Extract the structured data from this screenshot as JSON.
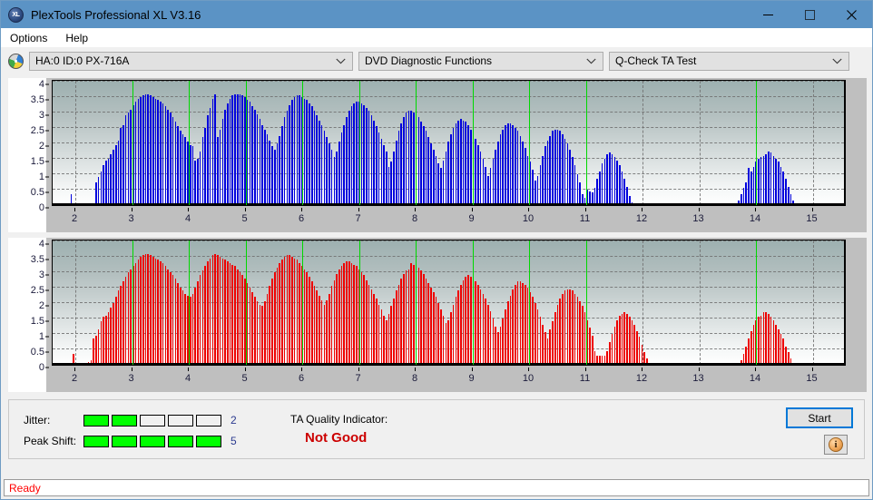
{
  "window": {
    "title": "PlexTools Professional XL V3.16",
    "app_icon": "XL",
    "controls": {
      "minimize": "minimize-icon",
      "maximize": "maximize-icon",
      "close": "close-icon"
    }
  },
  "menubar": {
    "items": [
      {
        "label": "Options"
      },
      {
        "label": "Help"
      }
    ]
  },
  "selectbar": {
    "drive_icon": "disc-icon",
    "drive": "HA:0 ID:0  PX-716A",
    "function_group": "DVD Diagnostic Functions",
    "test": "Q-Check TA Test",
    "caret": "˅"
  },
  "results": {
    "jitter_label": "Jitter:",
    "jitter_value": "2",
    "jitter_filled": 2,
    "jitter_total": 5,
    "peakshift_label": "Peak Shift:",
    "peakshift_value": "5",
    "peakshift_filled": 5,
    "peakshift_total": 5,
    "quality_label": "TA Quality Indicator:",
    "quality_value": "Not Good",
    "quality_color": "#cc0000",
    "meter_on_color": "#00ff00",
    "start_label": "Start",
    "info_label": "i"
  },
  "statusbar": {
    "text": "Ready",
    "color": "#ff0000"
  },
  "chart_data": [
    {
      "type": "bar",
      "name": "ta-test-chart-top",
      "series_color": "#0000dd",
      "marker_color": "#00d900",
      "ylabel": "",
      "xlabel": "",
      "ylim": [
        0,
        4
      ],
      "yticks": [
        0,
        0.5,
        1,
        1.5,
        2,
        2.5,
        3,
        3.5,
        4
      ],
      "ytick_labels": [
        "0",
        "0.5",
        "1",
        "1.5",
        "2",
        "2.5",
        "3",
        "3.5",
        "4"
      ],
      "xlim": [
        1.6,
        15.6
      ],
      "xticks": [
        2,
        3,
        4,
        5,
        6,
        7,
        8,
        9,
        10,
        11,
        12,
        13,
        14,
        15
      ],
      "xtick_labels": [
        "2",
        "3",
        "4",
        "5",
        "6",
        "7",
        "8",
        "9",
        "10",
        "11",
        "12",
        "13",
        "14",
        "15"
      ],
      "grid": true,
      "grid_v_at": [
        2,
        12,
        13,
        15
      ],
      "markers_at": [
        3,
        4,
        5,
        6,
        7,
        8,
        9,
        10,
        11,
        14
      ],
      "values": [
        0.0,
        0.0,
        0.0,
        0.05,
        0.0,
        0.0,
        0.0,
        0.35,
        0.05,
        0.0,
        0.0,
        0.0,
        0.0,
        0.0,
        0.0,
        0.0,
        0.0,
        0.75,
        0.9,
        1.1,
        1.3,
        1.45,
        1.5,
        1.65,
        1.8,
        1.95,
        2.1,
        2.5,
        2.6,
        2.9,
        3.0,
        3.1,
        3.25,
        3.35,
        3.45,
        3.5,
        3.55,
        3.6,
        3.6,
        3.55,
        3.5,
        3.45,
        3.4,
        3.35,
        3.3,
        3.2,
        3.1,
        3.0,
        2.85,
        2.7,
        2.55,
        2.4,
        2.3,
        2.2,
        2.05,
        1.95,
        1.9,
        1.45,
        1.5,
        1.75,
        2.2,
        2.5,
        2.9,
        3.15,
        3.45,
        3.6,
        2.2,
        2.45,
        2.8,
        3.1,
        3.3,
        3.45,
        3.55,
        3.6,
        3.6,
        3.6,
        3.55,
        3.5,
        3.4,
        3.35,
        3.2,
        3.1,
        2.95,
        2.8,
        2.6,
        2.45,
        2.3,
        2.1,
        1.9,
        1.8,
        2.0,
        2.25,
        2.55,
        2.85,
        3.05,
        3.25,
        3.4,
        3.5,
        3.55,
        3.55,
        3.5,
        3.45,
        3.4,
        3.3,
        3.2,
        3.05,
        2.9,
        2.75,
        2.6,
        2.4,
        2.2,
        2.0,
        1.8,
        1.55,
        1.75,
        2.05,
        2.35,
        2.6,
        2.85,
        3.05,
        3.2,
        3.3,
        3.35,
        3.35,
        3.3,
        3.25,
        3.15,
        3.05,
        2.9,
        2.75,
        2.55,
        2.35,
        2.15,
        1.95,
        1.75,
        1.25,
        1.4,
        1.75,
        2.1,
        2.4,
        2.65,
        2.85,
        3.0,
        3.05,
        3.05,
        3.0,
        2.95,
        2.85,
        2.7,
        2.55,
        2.4,
        2.2,
        2.0,
        1.8,
        1.6,
        1.35,
        1.2,
        1.45,
        1.75,
        2.05,
        2.3,
        2.5,
        2.65,
        2.75,
        2.8,
        2.75,
        2.7,
        2.6,
        2.45,
        2.3,
        2.15,
        1.95,
        1.75,
        1.5,
        1.25,
        0.95,
        1.2,
        1.5,
        1.8,
        2.05,
        2.3,
        2.45,
        2.6,
        2.65,
        2.65,
        2.6,
        2.5,
        2.4,
        2.25,
        2.05,
        1.85,
        1.6,
        1.4,
        1.15,
        0.8,
        0.95,
        1.3,
        1.6,
        1.9,
        2.1,
        2.25,
        2.4,
        2.45,
        2.45,
        2.4,
        2.3,
        2.15,
        2.0,
        1.8,
        1.55,
        1.3,
        1.0,
        0.75,
        0.35,
        0.25,
        0.5,
        0.45,
        0.4,
        0.55,
        0.85,
        1.1,
        1.35,
        1.5,
        1.65,
        1.7,
        1.65,
        1.55,
        1.45,
        1.3,
        1.1,
        0.85,
        0.6,
        0.3,
        0.1,
        0.05,
        0.0,
        0.0,
        0.0,
        0.0,
        0.0,
        0.0,
        0.0,
        0.0,
        0.0,
        0.0,
        0.0,
        0.0,
        0.0,
        0.0,
        0.0,
        0.0,
        0.0,
        0.0,
        0.0,
        0.0,
        0.0,
        0.0,
        0.0,
        0.0,
        0.0,
        0.0,
        0.0,
        0.0,
        0.0,
        0.0,
        0.0,
        0.0,
        0.0,
        0.0,
        0.0,
        0.0,
        0.0,
        0.0,
        0.0,
        0.0,
        0.05,
        0.15,
        0.35,
        0.55,
        0.75,
        1.2,
        1.1,
        1.25,
        1.4,
        1.5,
        1.55,
        1.6,
        1.65,
        1.75,
        1.7,
        1.6,
        1.5,
        1.4,
        1.25,
        1.1,
        0.85,
        0.6,
        0.35,
        0.15,
        0.05,
        0.0,
        0.0,
        0.0,
        0.0,
        0.0,
        0.0,
        0.0,
        0.0,
        0.0,
        0.0,
        0.0,
        0.0,
        0.0,
        0.0,
        0.0,
        0.0,
        0.0,
        0.0,
        0.0,
        0.0
      ]
    },
    {
      "type": "bar",
      "name": "ta-test-chart-bottom",
      "series_color": "#ee0000",
      "marker_color": "#00d900",
      "ylabel": "",
      "xlabel": "",
      "ylim": [
        0,
        4
      ],
      "yticks": [
        0,
        0.5,
        1,
        1.5,
        2,
        2.5,
        3,
        3.5,
        4
      ],
      "ytick_labels": [
        "0",
        "0.5",
        "1",
        "1.5",
        "2",
        "2.5",
        "3",
        "3.5",
        "4"
      ],
      "xlim": [
        1.6,
        15.6
      ],
      "xticks": [
        2,
        3,
        4,
        5,
        6,
        7,
        8,
        9,
        10,
        11,
        12,
        13,
        14,
        15
      ],
      "xtick_labels": [
        "2",
        "3",
        "4",
        "5",
        "6",
        "7",
        "8",
        "9",
        "10",
        "11",
        "12",
        "13",
        "14",
        "15"
      ],
      "grid": true,
      "grid_v_at": [
        2,
        12,
        13,
        15
      ],
      "markers_at": [
        3,
        4,
        5,
        6,
        7,
        8,
        9,
        10,
        11,
        14
      ],
      "values": [
        0.0,
        0.0,
        0.0,
        0.05,
        0.05,
        0.0,
        0.0,
        0.0,
        0.35,
        0.0,
        0.0,
        0.0,
        0.0,
        0.05,
        0.1,
        0.15,
        0.85,
        0.95,
        1.15,
        1.4,
        1.55,
        1.6,
        1.7,
        1.85,
        2.0,
        2.2,
        2.4,
        2.55,
        2.7,
        2.85,
        3.0,
        3.1,
        3.2,
        3.3,
        3.4,
        3.5,
        3.55,
        3.6,
        3.6,
        3.55,
        3.5,
        3.45,
        3.4,
        3.35,
        3.3,
        3.2,
        3.1,
        3.0,
        2.9,
        2.8,
        2.65,
        2.5,
        2.4,
        2.3,
        2.25,
        2.2,
        2.3,
        2.5,
        2.7,
        2.9,
        3.05,
        3.2,
        3.35,
        3.45,
        3.55,
        3.6,
        3.55,
        3.5,
        3.45,
        3.4,
        3.35,
        3.3,
        3.25,
        3.2,
        3.1,
        3.0,
        2.9,
        2.8,
        2.65,
        2.5,
        2.35,
        2.2,
        2.05,
        1.95,
        1.9,
        2.05,
        2.3,
        2.55,
        2.8,
        3.0,
        3.15,
        3.3,
        3.4,
        3.5,
        3.55,
        3.55,
        3.5,
        3.45,
        3.4,
        3.3,
        3.2,
        3.1,
        3.0,
        2.85,
        2.7,
        2.55,
        2.4,
        2.25,
        2.1,
        1.95,
        2.1,
        2.3,
        2.55,
        2.75,
        2.95,
        3.1,
        3.2,
        3.3,
        3.35,
        3.35,
        3.3,
        3.25,
        3.2,
        3.1,
        3.0,
        2.9,
        2.75,
        2.6,
        2.45,
        2.3,
        2.15,
        1.95,
        1.8,
        1.6,
        1.45,
        1.65,
        1.9,
        2.15,
        2.4,
        2.6,
        2.8,
        2.95,
        3.05,
        3.1,
        3.3,
        3.25,
        3.2,
        3.15,
        3.05,
        2.95,
        2.8,
        2.65,
        2.5,
        2.35,
        2.2,
        2.0,
        1.8,
        1.6,
        1.35,
        1.45,
        1.7,
        1.95,
        2.2,
        2.4,
        2.6,
        2.75,
        2.85,
        2.9,
        2.85,
        2.8,
        2.7,
        2.6,
        2.45,
        2.3,
        2.15,
        1.95,
        1.75,
        1.5,
        1.25,
        1.05,
        1.25,
        1.5,
        1.8,
        2.05,
        2.25,
        2.45,
        2.6,
        2.7,
        2.7,
        2.65,
        2.6,
        2.5,
        2.35,
        2.2,
        2.0,
        1.8,
        1.55,
        1.3,
        1.05,
        0.85,
        1.15,
        1.4,
        1.7,
        1.95,
        2.15,
        2.3,
        2.4,
        2.45,
        2.45,
        2.4,
        2.3,
        2.2,
        2.05,
        1.9,
        1.7,
        1.45,
        1.2,
        0.95,
        0.45,
        0.3,
        0.3,
        0.3,
        0.3,
        0.45,
        0.75,
        1.0,
        1.25,
        1.45,
        1.6,
        1.65,
        1.7,
        1.65,
        1.55,
        1.45,
        1.3,
        1.1,
        0.9,
        0.65,
        0.4,
        0.2,
        0.05,
        0.0,
        0.0,
        0.0,
        0.0,
        0.0,
        0.0,
        0.0,
        0.0,
        0.0,
        0.0,
        0.0,
        0.0,
        0.0,
        0.0,
        0.0,
        0.0,
        0.0,
        0.0,
        0.0,
        0.0,
        0.0,
        0.0,
        0.0,
        0.0,
        0.0,
        0.0,
        0.0,
        0.0,
        0.0,
        0.0,
        0.0,
        0.0,
        0.0,
        0.0,
        0.0,
        0.05,
        0.15,
        0.35,
        0.6,
        0.85,
        1.1,
        1.3,
        1.45,
        1.55,
        1.6,
        1.7,
        1.7,
        1.65,
        1.55,
        1.45,
        1.3,
        1.15,
        1.0,
        0.85,
        0.6,
        0.4,
        0.2,
        0.05,
        0.0,
        0.0,
        0.0,
        0.0,
        0.0,
        0.0,
        0.0,
        0.0,
        0.0,
        0.0,
        0.0,
        0.0,
        0.0,
        0.0,
        0.0,
        0.0,
        0.0,
        0.0,
        0.0,
        0.0,
        0.0
      ]
    }
  ]
}
